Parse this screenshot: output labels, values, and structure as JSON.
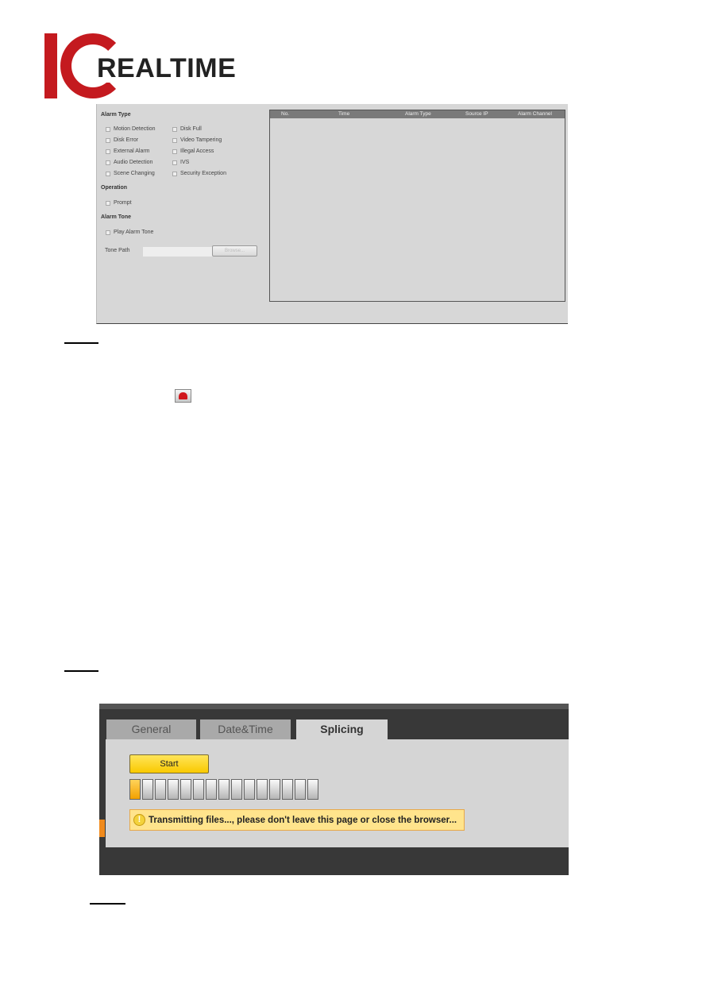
{
  "logo": {
    "mark": "IC",
    "wordmark": "REALTIME",
    "brand_color": "#c41a1f"
  },
  "alarm_panel": {
    "alarm_type_title": "Alarm Type",
    "alarm_types_left": [
      "Motion Detection",
      "Disk Error",
      "External Alarm",
      "Audio Detection",
      "Scene Changing"
    ],
    "alarm_types_right": [
      "Disk Full",
      "Video Tampering",
      "Illegal Access",
      "IVS",
      "Security Exception"
    ],
    "operation_title": "Operation",
    "operation_options": [
      "Prompt"
    ],
    "alarm_tone_title": "Alarm Tone",
    "alarm_tone_options": [
      "Play Alarm Tone"
    ],
    "tone_path_label": "Tone Path",
    "tone_path_value": "",
    "browse_label": "Browse...",
    "table_columns": [
      "No.",
      "Time",
      "Alarm Type",
      "Source IP",
      "Alarm Channel"
    ],
    "table_rows": []
  },
  "inline_icon": "alarm-bell-icon",
  "splicing": {
    "tabs": [
      {
        "label": "General",
        "active": false
      },
      {
        "label": "Date&Time",
        "active": false
      },
      {
        "label": "Splicing",
        "active": true
      }
    ],
    "start_label": "Start",
    "progress": {
      "filled_segments": 1,
      "total_segments": 15
    },
    "notice_icon": "warning-icon",
    "notice_text": "Transmitting files..., please don't leave this page or close the browser...",
    "accent_color": "#f9c900"
  }
}
